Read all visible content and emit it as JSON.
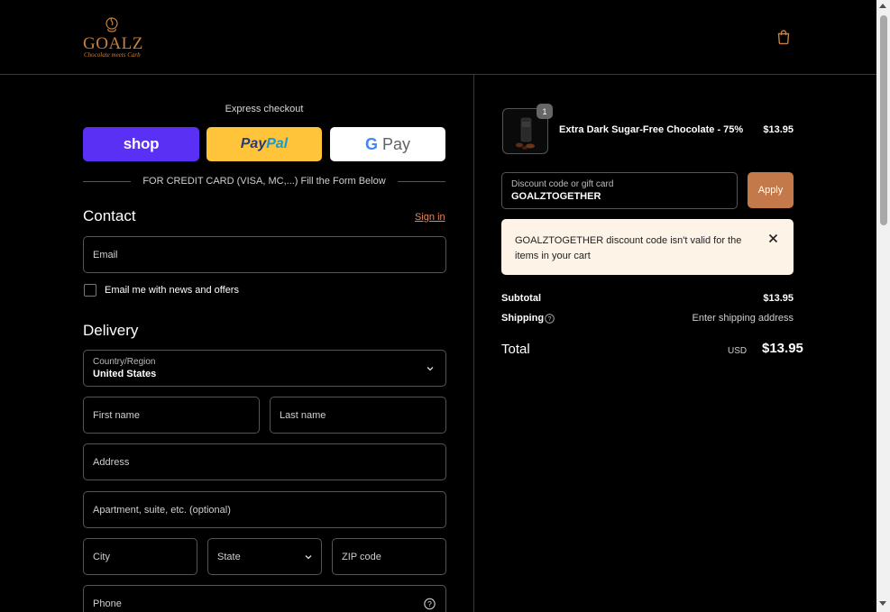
{
  "brand": {
    "name": "GOALZ",
    "tagline": "Chocolate meets Carb",
    "accent": "#c6803f"
  },
  "header": {
    "cart_icon": "shopping-bag-icon"
  },
  "express": {
    "title": "Express checkout",
    "shop_label": "shop",
    "paypal_label_1": "Pay",
    "paypal_label_2": "Pal",
    "gpay_g": "G",
    "gpay_label": " Pay",
    "divider_text": "FOR CREDIT CARD (VISA, MC,...) Fill the Form Below"
  },
  "contact": {
    "title": "Contact",
    "signin_label": "Sign in",
    "email_placeholder": "Email",
    "newsletter_label": "Email me with news and offers",
    "newsletter_checked": false
  },
  "delivery": {
    "title": "Delivery",
    "country_label": "Country/Region",
    "country_value": "United States",
    "first_name_placeholder": "First name",
    "last_name_placeholder": "Last name",
    "address_placeholder": "Address",
    "apartment_placeholder": "Apartment, suite, etc. (optional)",
    "city_placeholder": "City",
    "state_placeholder": "State",
    "zip_placeholder": "ZIP code",
    "phone_placeholder": "Phone"
  },
  "order": {
    "item": {
      "quantity": "1",
      "name": "Extra Dark Sugar-Free Chocolate - 75%",
      "price": "$13.95"
    },
    "discount": {
      "label": "Discount code or gift card",
      "value": "GOALZTOGETHER",
      "apply_label": "Apply",
      "error": "GOALZTOGETHER discount code isn't valid for the items in your cart"
    },
    "subtotal_label": "Subtotal",
    "subtotal_value": "$13.95",
    "shipping_label": "Shipping",
    "shipping_value": "Enter shipping address",
    "total_label": "Total",
    "total_currency": "USD",
    "total_value": "$13.95"
  },
  "colors": {
    "background": "#000000",
    "shop_purple": "#5a31f4",
    "paypal_yellow": "#ffc439",
    "apply_button": "#c4794a",
    "alert_bg": "#fdf3e7",
    "link": "#e0875a"
  }
}
